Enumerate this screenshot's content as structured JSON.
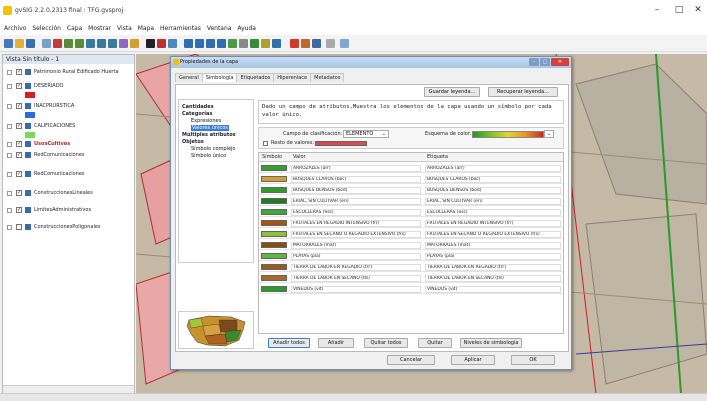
{
  "window": {
    "title": "gvSIG 2.2.0.2313 final : TFG.gvsproj",
    "controls": [
      "–",
      "□",
      "✕"
    ]
  },
  "menu": [
    "Archivo",
    "Selección",
    "Capa",
    "Mostrar",
    "Vista",
    "Mapa",
    "Herramientas",
    "Ventana",
    "Ayuda"
  ],
  "layers_panel": {
    "title": "Vista Sin título - 1",
    "layers": [
      "Patrimonio Rural Edificado Huerta",
      "DESERIADO",
      "INACPRURSTICA",
      "CALIFICACIONES",
      "UsosCultivos",
      "RedComunicaciones",
      "RedComunicaciones",
      "ConstruccionesLineales",
      "LimitesAdministrativos",
      "ConstruccionesPoligonales"
    ]
  },
  "dialog": {
    "title": "Propiedades de la capa",
    "tabs": [
      "General",
      "Simbología",
      "Etiquetados",
      "Hiperenlace",
      "Metadatos"
    ],
    "active_tab": "Simbología",
    "buttons_top": [
      "Guardar leyenda...",
      "Recuperar leyenda..."
    ],
    "tree": {
      "cantidades": "Cantidades",
      "categorias": "Categorías",
      "expresiones": "Expresiones",
      "valores_unicos": "Valores únicos",
      "multiples": "Múltiples atributos",
      "objetos": "Objetos",
      "simbolo_complejo": "Símbolo complejo",
      "simbolo_unico": "Símbolo único"
    },
    "description": "Dado un campo de atributos,Muestra los elementos de la capa usando un símbolo por cada valor único.",
    "campo_label": "Campo de clasificación:",
    "campo_value": "ELEMENTO",
    "esquema_label": "Esquema de color:",
    "resto_label": "Resto de valores:",
    "table_headers": [
      "Símbolo",
      "Valor",
      "Etiqueta"
    ],
    "rows": [
      {
        "color": "#31a02e",
        "valor": "ARROZALES (arr)",
        "etiqueta": "ARROZALES (arr)"
      },
      {
        "color": "#d1a032",
        "valor": "BOSQUES CLAROS (boc)",
        "etiqueta": "BOSQUES CLAROS (boc)"
      },
      {
        "color": "#2f9a2b",
        "valor": "BOSQUES DENSOS (bod)",
        "etiqueta": "BOSQUES DENSOS (bod)"
      },
      {
        "color": "#1f7c1f",
        "valor": "ERIAL, SIN CULTIVAR (eri)",
        "etiqueta": "ERIAL, SIN CULTIVAR (eri)"
      },
      {
        "color": "#3aa83a",
        "valor": "ESCOLLERAS (esc)",
        "etiqueta": "ESCOLLERAS (esc)"
      },
      {
        "color": "#a35518",
        "valor": "FRUTALES EN REGADÍO INTENSIVO (frr)",
        "etiqueta": "FRUTALES EN REGADÍO INTENSIVO (frr)"
      },
      {
        "color": "#8bc23a",
        "valor": "FRUTALES EN SECANO O REGADÍO EXTENSIVO (frs)",
        "etiqueta": "FRUTALES EN SECANO O REGADÍO EXTENSIVO (frs)"
      },
      {
        "color": "#8a4a14",
        "valor": "MATORRALES (mat)",
        "etiqueta": "MATORRALES (mat)"
      },
      {
        "color": "#5cb83a",
        "valor": "PLAYAS (pla)",
        "etiqueta": "PLAYAS (pla)"
      },
      {
        "color": "#9a5a1e",
        "valor": "TIERRA DE LABOR EN REGADÍO (trr)",
        "etiqueta": "TIERRA DE LABOR EN REGADÍO (trr)"
      },
      {
        "color": "#a86a2a",
        "valor": "TIERRA DE LABOR EN SECANO (tls)",
        "etiqueta": "TIERRA DE LABOR EN SECANO (tls)"
      },
      {
        "color": "#2a9a2a",
        "valor": "VIÑEDOS (vit)",
        "etiqueta": "VIÑEDOS (vit)"
      }
    ],
    "actions": [
      "Añadir todos",
      "Añadir",
      "Quitar todos",
      "Quitar",
      "Niveles de simbología"
    ],
    "footer": [
      "Cancelar",
      "Aplicar",
      "OK"
    ]
  },
  "colors": {
    "resto_color": "#d84b4b",
    "accent": "#3c7fd1"
  }
}
